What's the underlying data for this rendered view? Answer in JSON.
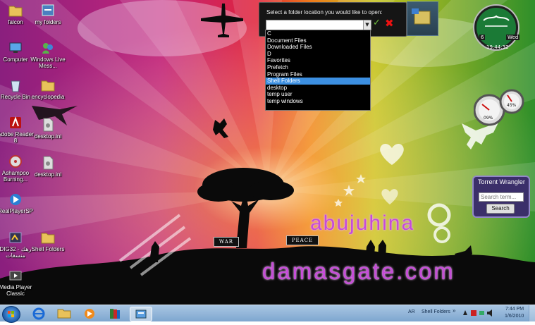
{
  "desktop_icons": [
    {
      "label": "falcon",
      "icon": "folder-icon"
    },
    {
      "label": "my folders",
      "icon": "shortcut-folder-icon"
    },
    {
      "label": "Computer",
      "icon": "computer-icon"
    },
    {
      "label": "Windows Live Mess...",
      "icon": "messenger-icon"
    },
    {
      "label": "Recycle Bin",
      "icon": "recycle-bin-icon"
    },
    {
      "label": "encyclopedia",
      "icon": "folder-icon"
    },
    {
      "label": "Adobe Reader 8",
      "icon": "adobe-reader-icon"
    },
    {
      "label": "desktop.ini",
      "icon": "ini-file-icon"
    },
    {
      "label": "Ashampoo Burning...",
      "icon": "ashampoo-icon"
    },
    {
      "label": "desktop.ini",
      "icon": "ini-file-icon"
    },
    {
      "label": "RealPlayerSP",
      "icon": "realplayer-icon"
    },
    {
      "label": "DIG32 - رهك منسقات",
      "icon": "dig32-icon"
    },
    {
      "label": "Shell Folders",
      "icon": "folder-icon"
    },
    {
      "label": "Media Player Classic",
      "icon": "media-player-icon"
    }
  ],
  "folder_dialog": {
    "prompt": "Select a folder location you would like to open:",
    "selected_value": "",
    "ok_symbol": "✓",
    "cancel_symbol": "✖",
    "options": [
      "C",
      "Document Files",
      "Downloaded Files",
      "D",
      "Favorites",
      "Prefetch",
      "Program Files",
      "Shell Folders",
      "desktop",
      "temp user",
      "temp windows"
    ],
    "highlighted_option": "Shell Folders"
  },
  "torrent_gadget": {
    "title": "Torrent Wrangler",
    "search_placeholder": "Search term...",
    "search_button": "Search"
  },
  "clock_gadget": {
    "day": "6",
    "weekday": "Wed",
    "time": "19:44:32"
  },
  "meter_gadget": {
    "cpu_percent": "09%",
    "ram_percent": "45%"
  },
  "wallpaper": {
    "sign_left": "WAR",
    "sign_right": "PEACE",
    "watermark_1": "abujuhina",
    "watermark_2": "damasgate.com"
  },
  "taskbar": {
    "apps": [
      "ie-icon",
      "explorer-icon",
      "media-player-icon",
      "books-icon",
      "control-panel-icon"
    ],
    "language": "AR",
    "toolbar_label": "Shell Folders",
    "expand_symbol": "»",
    "time": "7:44 PM",
    "date": "1/6/2010"
  },
  "colors": {
    "list_highlight": "#3c8fe1",
    "watermark": "#c64bd8",
    "taskbar": "#8fb3d9"
  }
}
